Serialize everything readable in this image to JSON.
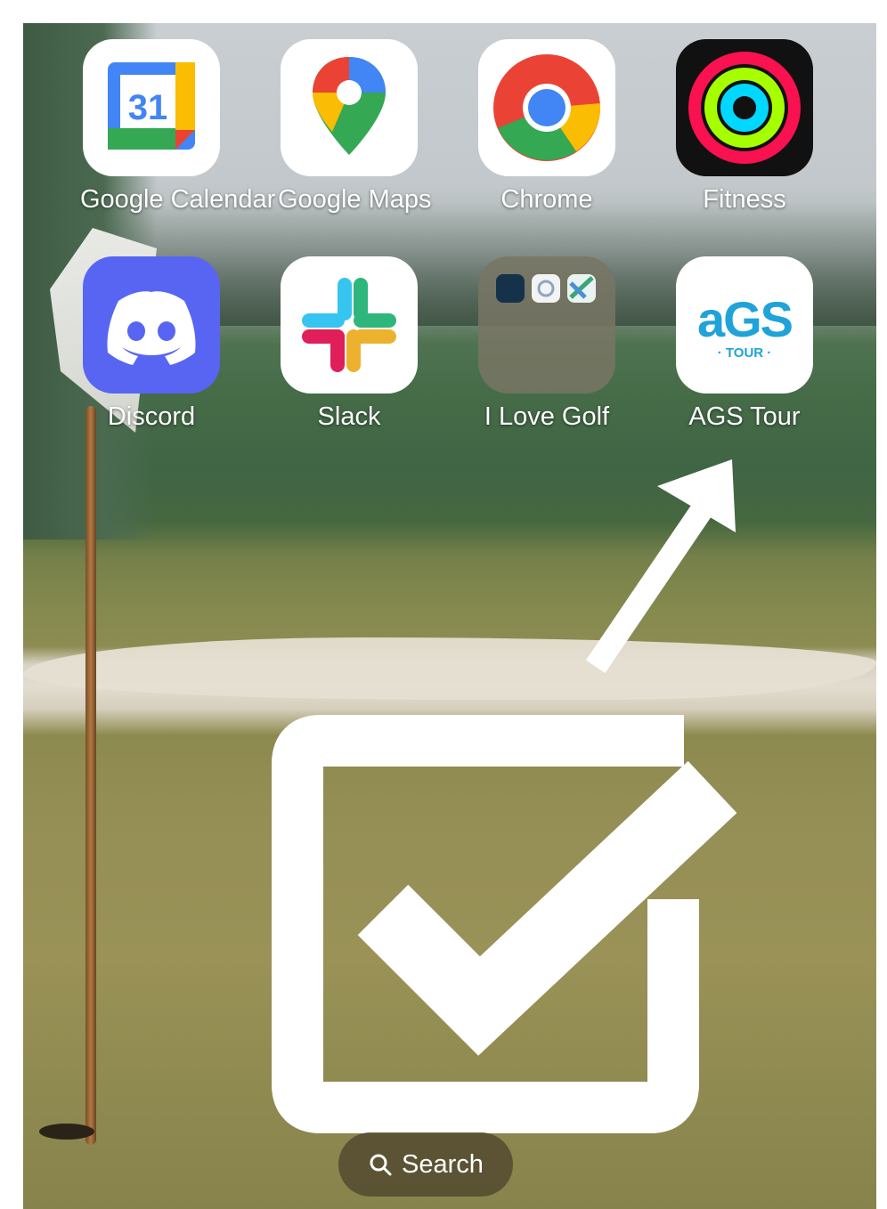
{
  "apps": [
    {
      "id": "google-calendar",
      "label": "Google Calendar",
      "day": "31"
    },
    {
      "id": "google-maps",
      "label": "Google Maps"
    },
    {
      "id": "chrome",
      "label": "Chrome"
    },
    {
      "id": "fitness",
      "label": "Fitness"
    },
    {
      "id": "discord",
      "label": "Discord"
    },
    {
      "id": "slack",
      "label": "Slack"
    },
    {
      "id": "folder",
      "label": "I Love Golf"
    },
    {
      "id": "ags-tour",
      "label": "AGS Tour",
      "logo_text": "aGS",
      "logo_sub": "· TOUR ·"
    }
  ],
  "search": {
    "label": "Search"
  },
  "colors": {
    "ags_blue": "#1fa3d8",
    "discord": "#5865f2"
  }
}
